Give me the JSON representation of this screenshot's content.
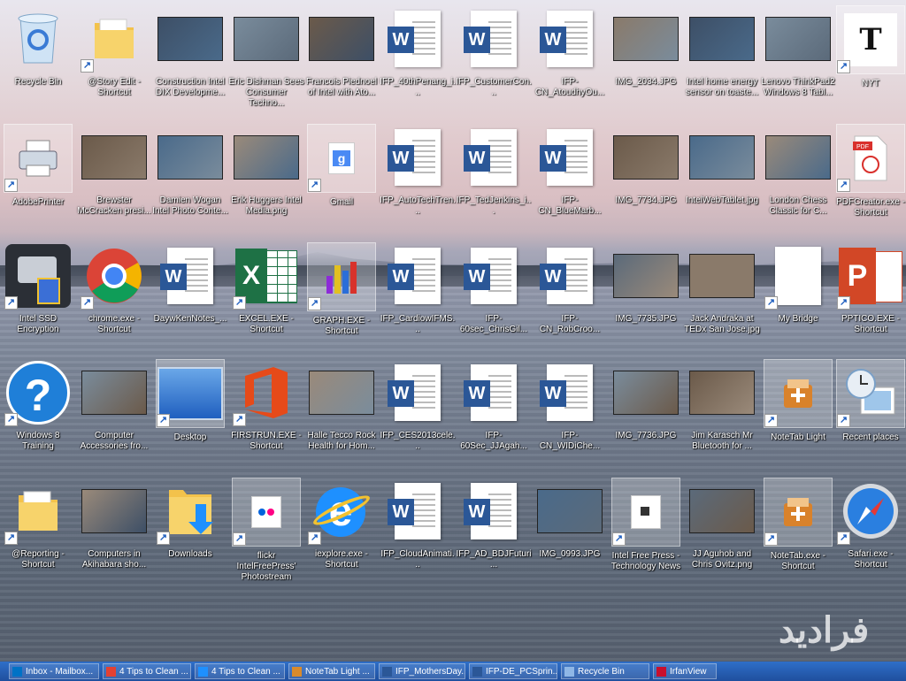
{
  "desktop": {
    "rows": [
      [
        {
          "label": "Recycle Bin",
          "kind": "recycle",
          "shortcut": false
        },
        {
          "label": "@Story Edit - Shortcut",
          "kind": "folder",
          "shortcut": true
        },
        {
          "label": "Construction Intel DIX Developme...",
          "kind": "photo",
          "shortcut": false
        },
        {
          "label": "Eric Dishman Sees Consumer Techno...",
          "kind": "photo",
          "shortcut": false
        },
        {
          "label": "Francois Piednoel of Intel with Ato...",
          "kind": "photo",
          "shortcut": false
        },
        {
          "label": "IFP_40thPenang_i...",
          "kind": "word",
          "shortcut": false
        },
        {
          "label": "IFP_CustomerCon...",
          "kind": "word",
          "shortcut": false
        },
        {
          "label": "IFP-CN_AtoudhyOu...",
          "kind": "word",
          "shortcut": false
        },
        {
          "label": "IMG_2034.JPG",
          "kind": "photo",
          "shortcut": false
        },
        {
          "label": "Intel home energy sensor on toaste...",
          "kind": "photo",
          "shortcut": false
        },
        {
          "label": "Lenovo ThinkPad2 Windows 8 Tabl...",
          "kind": "photo",
          "shortcut": false
        },
        {
          "label": "NYT",
          "kind": "nyt",
          "shortcut": true
        }
      ],
      [
        {
          "label": "AdobePrinter",
          "kind": "printer",
          "shortcut": true
        },
        {
          "label": "Brewster McCracken presi...",
          "kind": "photo",
          "shortcut": false
        },
        {
          "label": "Damien Wogan Intel Photo Conte...",
          "kind": "photo",
          "shortcut": false
        },
        {
          "label": "Erik Huggers Intel Media.png",
          "kind": "photo",
          "shortcut": false
        },
        {
          "label": "Gmail",
          "kind": "gmail",
          "shortcut": true
        },
        {
          "label": "IFP_AutoTechTren...",
          "kind": "word",
          "shortcut": false
        },
        {
          "label": "IFP_TedJenkins_i...",
          "kind": "word",
          "shortcut": false
        },
        {
          "label": "IFP-CN_BlueMarb...",
          "kind": "word",
          "shortcut": false
        },
        {
          "label": "IMG_7734.JPG",
          "kind": "photo",
          "shortcut": false
        },
        {
          "label": "IntelWebTablet.jpg",
          "kind": "photo",
          "shortcut": false
        },
        {
          "label": "London Chess Classic for C...",
          "kind": "photo",
          "shortcut": false
        },
        {
          "label": "PDFCreator.exe - Shortcut",
          "kind": "pdf",
          "shortcut": true
        }
      ],
      [
        {
          "label": "Intel SSD Encryption",
          "kind": "ssd",
          "shortcut": true
        },
        {
          "label": "chrome.exe - Shortcut",
          "kind": "chrome",
          "shortcut": true
        },
        {
          "label": "DaywKenNotes_...",
          "kind": "word",
          "shortcut": false
        },
        {
          "label": "EXCEL.EXE - Shortcut",
          "kind": "excel",
          "shortcut": true
        },
        {
          "label": "GRAPH.EXE - Shortcut",
          "kind": "graph",
          "shortcut": true
        },
        {
          "label": "IFP_CardiowIFMS...",
          "kind": "word",
          "shortcut": false
        },
        {
          "label": "IFP-60sec_ChrisGil...",
          "kind": "word",
          "shortcut": false
        },
        {
          "label": "IFP-CN_RobCroo...",
          "kind": "word",
          "shortcut": false
        },
        {
          "label": "IMG_7735.JPG",
          "kind": "photo",
          "shortcut": false
        },
        {
          "label": "Jack Andraka at TEDx San Jose.jpg",
          "kind": "photo",
          "shortcut": false
        },
        {
          "label": "My Bridge",
          "kind": "blank",
          "shortcut": true
        },
        {
          "label": "PPTICO.EXE - Shortcut",
          "kind": "ppt",
          "shortcut": true
        }
      ],
      [
        {
          "label": "Windows 8 Training",
          "kind": "help",
          "shortcut": true
        },
        {
          "label": "Computer Accessories fro...",
          "kind": "photo",
          "shortcut": false
        },
        {
          "label": "Desktop",
          "kind": "desktop",
          "shortcut": true
        },
        {
          "label": "FIRSTRUN.EXE - Shortcut",
          "kind": "office",
          "shortcut": true
        },
        {
          "label": "Halle Tecco Rock Health for Hom...",
          "kind": "photo",
          "shortcut": false
        },
        {
          "label": "IFP_CES2013cele...",
          "kind": "word",
          "shortcut": false
        },
        {
          "label": "IFP-60Sec_JJAgah...",
          "kind": "word",
          "shortcut": false
        },
        {
          "label": "IFP-CN_WIDiChe...",
          "kind": "word",
          "shortcut": false
        },
        {
          "label": "IMG_7736.JPG",
          "kind": "photo",
          "shortcut": false
        },
        {
          "label": "Jim Karasch Mr Bluetooth for ...",
          "kind": "photo",
          "shortcut": false
        },
        {
          "label": "NoteTab Light",
          "kind": "notetab",
          "shortcut": true
        },
        {
          "label": "Recent places",
          "kind": "recent",
          "shortcut": true
        }
      ],
      [
        {
          "label": "@Reporting - Shortcut",
          "kind": "folder",
          "shortcut": true
        },
        {
          "label": "Computers in Akihabara sho...",
          "kind": "photo",
          "shortcut": false
        },
        {
          "label": "Downloads",
          "kind": "downloads",
          "shortcut": true
        },
        {
          "label": "flickr IntelFreePress' Photostream",
          "kind": "flickr",
          "shortcut": true
        },
        {
          "label": "iexplore.exe - Shortcut",
          "kind": "ie",
          "shortcut": true
        },
        {
          "label": "IFP_CloudAnimati...",
          "kind": "word",
          "shortcut": false
        },
        {
          "label": "IFP_AD_BDJFuturi...",
          "kind": "word",
          "shortcut": false
        },
        {
          "label": "IMG_0993.JPG",
          "kind": "photo",
          "shortcut": false
        },
        {
          "label": "Intel Free Press - Technology News",
          "kind": "page",
          "shortcut": true
        },
        {
          "label": "JJ Aguhob and Chris Ovitz.png",
          "kind": "photo",
          "shortcut": false
        },
        {
          "label": "NoteTab.exe - Shortcut",
          "kind": "notetab",
          "shortcut": true
        },
        {
          "label": "Safari.exe - Shortcut",
          "kind": "safari",
          "shortcut": true
        }
      ]
    ],
    "watermark": "فرادید"
  },
  "taskbar": {
    "items": [
      {
        "label": "Inbox - Mailbox...",
        "color": "#0072c6"
      },
      {
        "label": "4 Tips to Clean ...",
        "color": "#e34133"
      },
      {
        "label": "4 Tips to Clean ...",
        "color": "#1e90ff"
      },
      {
        "label": "NoteTab Light ...",
        "color": "#d98a2b"
      },
      {
        "label": "IFP_MothersDay...",
        "color": "#2b5797"
      },
      {
        "label": "IFP-DE_PCSprin...",
        "color": "#2b5797"
      },
      {
        "label": "Recycle Bin",
        "color": "#8fb7e6"
      },
      {
        "label": "IrfanView",
        "color": "#c8102e"
      }
    ]
  },
  "colors": {
    "taskbar": "#2a62b8",
    "word": "#2b5797",
    "excel": "#1e7145",
    "ppt": "#d24726"
  }
}
